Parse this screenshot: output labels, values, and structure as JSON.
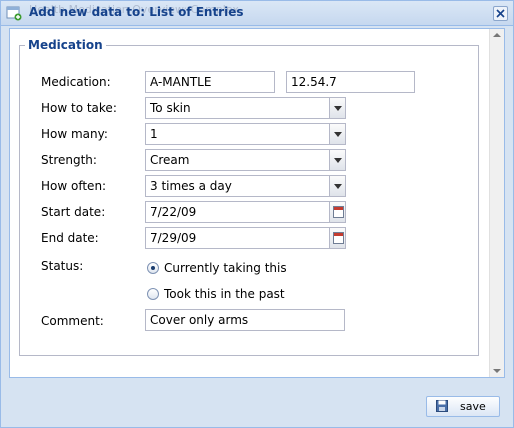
{
  "window": {
    "ghost_title": "Health Medication Overview: Complex",
    "title": "Add new data to: List of Entries"
  },
  "form": {
    "legend": "Medication",
    "labels": {
      "medication": "Medication:",
      "how_to_take": "How to take:",
      "how_many": "How many:",
      "strength": "Strength:",
      "how_often": "How often:",
      "start_date": "Start date:",
      "end_date": "End date:",
      "status": "Status:",
      "comment": "Comment:"
    },
    "values": {
      "medication_name": "A-MANTLE",
      "medication_code": "12.54.7",
      "how_to_take": "To skin",
      "how_many": "1",
      "strength": "Cream",
      "how_often": "3 times a day",
      "start_date": "7/22/09",
      "end_date": "7/29/09",
      "comment": "Cover only arms"
    },
    "status_options": [
      {
        "label": "Currently taking this",
        "checked": true
      },
      {
        "label": "Took this in the past",
        "checked": false
      }
    ]
  },
  "footer": {
    "save_label": "save"
  },
  "icons": {
    "title_icon": "add-window-icon",
    "close": "close-icon",
    "save": "save-icon",
    "calendar": "calendar-icon",
    "dropdown": "chevron-down-icon"
  },
  "colors": {
    "title_text": "#15428b",
    "legend_text": "#15428b",
    "window_bg": "#d6e3f2"
  }
}
